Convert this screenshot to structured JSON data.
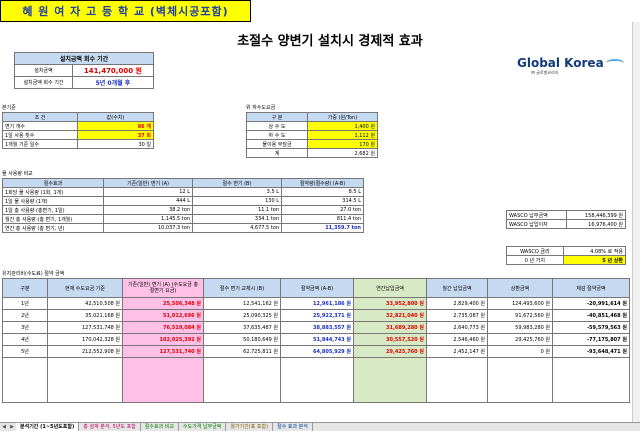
{
  "school_title": "혜 원 여 자 고 등 학 교 (벽체시공포함)",
  "main_title": "초절수 양변기 설치시 경제적 효과",
  "logo": {
    "name": "Global Korea",
    "sub": "㈜ 글로벌코리아"
  },
  "summary": {
    "header": "설치금액 회수 기간",
    "rows": [
      {
        "label": "설치금액",
        "value": "141,470,000 원"
      },
      {
        "label": "설치금액 회수 기간",
        "value": "5년 0개월 후"
      }
    ]
  },
  "basic": {
    "title": "본기준",
    "headers": [
      "조 건",
      "값(수치)"
    ],
    "rows": [
      {
        "label": "변기 개수",
        "value": "86 개"
      },
      {
        "label": "1일 사용 횟수",
        "value": "37 회"
      },
      {
        "label": "1개월 기준 일수",
        "value": "30 일"
      }
    ]
  },
  "water_rate": {
    "title": "위 하수도요금",
    "headers": [
      "구 분",
      "가중 (원/Ton)"
    ],
    "rows": [
      {
        "label": "상 수 도",
        "value": "1,400 원"
      },
      {
        "label": "하 수 도",
        "value": "1,112 원"
      },
      {
        "label": "물이용 부담금",
        "value": "170 원"
      },
      {
        "label": "계",
        "value": "2,682 원"
      }
    ]
  },
  "usage": {
    "title": "물 사용량 비교",
    "headers": [
      "절수효과",
      "기존(일반) 변기 (A)",
      "절수 변기 (B)",
      "절약량(절수량) (A-B)"
    ],
    "rows": [
      [
        "1회당 물 사용량 (1회, 1개)",
        "12 L",
        "3.5 L",
        "8.5 L"
      ],
      [
        "1일 물 사용량 (1개)",
        "444 L",
        "130 L",
        "314.5 L"
      ],
      [
        "1일 총 사용량 (총변기, 1일)",
        "38.2 ton",
        "11.1 ton",
        "27.0 ton"
      ],
      [
        "월간 총 사용량 (총 변기, 1개월)",
        "1,145.5 ton",
        "334.1 ton",
        "811.4 ton"
      ],
      [
        "연간 총 사용량 (총 변기, 년)",
        "10,037.3 ton",
        "4,677.5 ton",
        "11,359.7 ton"
      ]
    ]
  },
  "wasco": {
    "rows": [
      {
        "label": "WASCO 납부금액",
        "value": "158,446,399 원"
      },
      {
        "label": "WASCO 납입이자",
        "value": "16,976,400 원"
      }
    ],
    "rate_label": "WASCO 금리",
    "rate_value": "4.08% 로 적용",
    "period_label": "0 년 거치",
    "period_value": "5 년 상환"
  },
  "maint": {
    "title": "유지관리비(수도료) 절약 금액",
    "headers": [
      "구분",
      "현재 수도요금 기준",
      "기존(일반) 변기 (A) (수도요금 총 절변기 요금)",
      "절수 변기 교체시 (B)",
      "절약금액 (A-B)",
      "연간납입금액",
      "월간 납입금액",
      "상환금액",
      "체감 절약금액"
    ],
    "rows": [
      [
        "1년",
        "42,510,508 원",
        "25,506,348 원",
        "12,541,162 원",
        "12,961,186 원",
        "33,952,800 원",
        "2,829,400 원",
        "124,493,600 원",
        "-20,991,614 원"
      ],
      [
        "2년",
        "35,021,168 원",
        "51,012,696 원",
        "25,090,325 원",
        "25,922,371 원",
        "32,821,040 원",
        "2,735,087 원",
        "91,672,560 원",
        "-40,851,468 원"
      ],
      [
        "3년",
        "127,531,748 원",
        "76,519,084 원",
        "37,635,487 원",
        "38,883,557 원",
        "31,689,280 원",
        "2,640,773 원",
        "59,983,280 원",
        "-59,579,563 원"
      ],
      [
        "4년",
        "170,042,328 원",
        "102,025,392 원",
        "50,180,649 원",
        "51,844,743 원",
        "30,557,520 원",
        "2,546,460 원",
        "29,425,760 원",
        "-77,175,807 원"
      ],
      [
        "5년",
        "212,552,908 원",
        "127,531,740 원",
        "62,725,811 원",
        "64,805,929 원",
        "29,425,760 원",
        "2,452,147 원",
        "0 원",
        "-93,648,471 원"
      ]
    ]
  },
  "tabs": [
    "분석기간 (1~5년도포함)",
    "총 설계 분석, 5년도 포함",
    "절수효과 비교",
    "수도가격 납부금액",
    "월가기간(표 포함)",
    "절수 효과 분석"
  ]
}
